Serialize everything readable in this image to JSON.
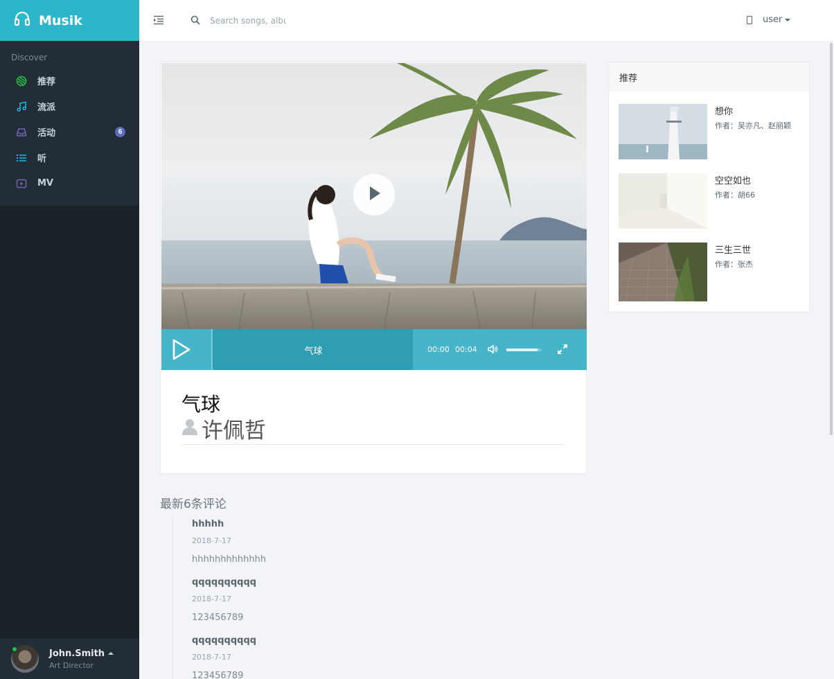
{
  "brand": {
    "name": "Musik"
  },
  "nav": {
    "header": "Discover",
    "items": [
      {
        "label": "推荐",
        "icon": "recommend-icon",
        "color": "#27c24c"
      },
      {
        "label": "流派",
        "icon": "music-note-icon",
        "color": "#23b7e5"
      },
      {
        "label": "活动",
        "icon": "inbox-icon",
        "color": "#7266ba",
        "badge": "6"
      },
      {
        "label": "听",
        "icon": "list-icon",
        "color": "#23b7e5"
      },
      {
        "label": "MV",
        "icon": "video-icon",
        "color": "#7266ba"
      }
    ]
  },
  "profile": {
    "name": "John.Smith",
    "role": "Art Director",
    "online": true
  },
  "topbar": {
    "search_placeholder": "Search songs, albums",
    "user_label": "user"
  },
  "player": {
    "track_title": "气球",
    "time_current": "00:00",
    "time_duration": "00:04",
    "volume": 0.9,
    "accent": "#47b5c9"
  },
  "song": {
    "title": "气球",
    "artist": "许佩哲"
  },
  "comments": {
    "title": "最新6条评论",
    "items": [
      {
        "user": "hhhhh",
        "date": "2018-7-17",
        "text": "hhhhhhhhhhhhh"
      },
      {
        "user": "qqqqqqqqqq",
        "date": "2018-7-17",
        "text": "123456789"
      },
      {
        "user": "qqqqqqqqqq",
        "date": "2018-7-17",
        "text": "123456789"
      }
    ]
  },
  "recommend": {
    "title": "推荐",
    "items": [
      {
        "title": "想你",
        "author": "作者：吴亦凡、赵丽颖"
      },
      {
        "title": "空空如也",
        "author": "作者：胡66"
      },
      {
        "title": "三生三世",
        "author": "作者：张杰"
      }
    ]
  }
}
